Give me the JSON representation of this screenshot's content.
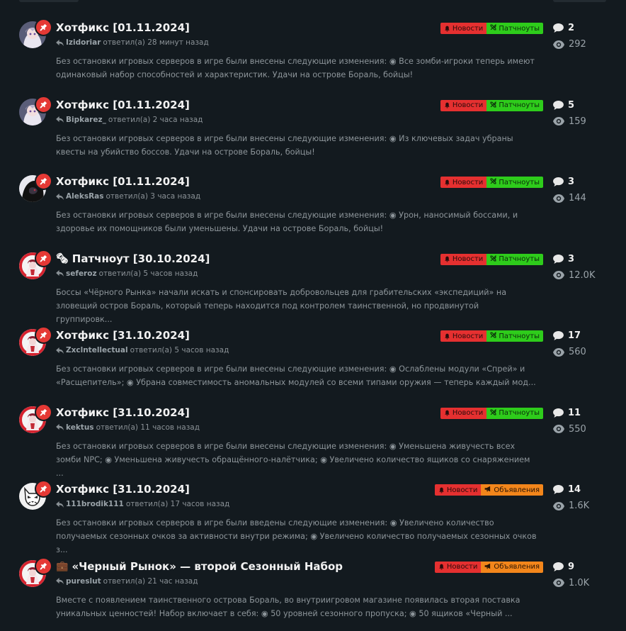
{
  "colors": {
    "background": "#131a1f",
    "pin": "#e53935",
    "tag_news": "#e53030",
    "tag_patch": "#2ecc1b",
    "tag_announce": "#f3861b"
  },
  "threads": [
    {
      "title": "Хотфикс [01.11.2024]",
      "title_icon": "",
      "user": "Izidoriar",
      "reply_text": "ответил(а) 28 минут назад",
      "excerpt": "Без остановки игровых серверов в игре были внесены следующие изменения: ◉ Все зомби-игроки теперь имеют одинаковый набор способностей и характеристик. Удачи на острове Бораль, бойцы!",
      "tag1": "Новости",
      "tag2": "Патчноуты",
      "tag2_type": "patch",
      "replies": "2",
      "views": "292",
      "avatar": "anime"
    },
    {
      "title": "Хотфикс [01.11.2024]",
      "title_icon": "",
      "user": "Bipkarez_",
      "reply_text": "ответил(а) 2 часа назад",
      "excerpt": "Без остановки игровых серверов в игре были внесены следующие изменения: ◉ Из ключевых задач убраны квесты на убийство боссов. Удачи на острове Бораль, бойцы!",
      "tag1": "Новости",
      "tag2": "Патчноуты",
      "tag2_type": "patch",
      "replies": "5",
      "views": "159",
      "avatar": "anime"
    },
    {
      "title": "Хотфикс [01.11.2024]",
      "title_icon": "",
      "user": "AleksRas",
      "reply_text": "ответил(а) 3 часа назад",
      "excerpt": "Без остановки игровых серверов в игре были внесены следующие изменения: ◉ Урон, наносимый боссами, и здоровье их помощников были уменьшены. Удачи на острове Бораль, бойцы!",
      "tag1": "Новости",
      "tag2": "Патчноуты",
      "tag2_type": "patch",
      "replies": "3",
      "views": "144",
      "avatar": "dark"
    },
    {
      "title": "Патчноут [30.10.2024]",
      "title_icon": "🗞",
      "user": "seferoz",
      "reply_text": "ответил(а) 5 часов назад",
      "excerpt": "Боссы «Чёрного Рынка» начали искать и спонсировать добровольцев для грабительских «экспедиций» на зловещий остров Бораль, который теперь находится под контролем таинственной, но продвинутой группировк...",
      "tag1": "Новости",
      "tag2": "Патчноуты",
      "tag2_type": "patch",
      "replies": "3",
      "views": "12.0K",
      "avatar": "red"
    },
    {
      "title": "Хотфикс [31.10.2024]",
      "title_icon": "",
      "user": "Zxclntellectual",
      "reply_text": "ответил(а) 5 часов назад",
      "excerpt": "Без остановки игровых серверов в игре были внесены следующие изменения: ◉ Ослаблены модули «Спрей» и «Расщепитель»; ◉ Убрана совместимость аномальных модулей со всеми типами оружия — теперь каждый мод...",
      "tag1": "Новости",
      "tag2": "Патчноуты",
      "tag2_type": "patch",
      "replies": "17",
      "views": "560",
      "avatar": "red"
    },
    {
      "title": "Хотфикс [31.10.2024]",
      "title_icon": "",
      "user": "kektus",
      "reply_text": "ответил(а) 11 часов назад",
      "excerpt": "Без остановки игровых серверов в игре были внесены следующие изменения: ◉ Уменьшена живучесть всех зомби NPC; ◉ Уменьшена живучесть обращённого-налётчика; ◉ Увеличено количество ящиков со снаряжением ...",
      "tag1": "Новости",
      "tag2": "Патчноуты",
      "tag2_type": "patch",
      "replies": "11",
      "views": "550",
      "avatar": "red"
    },
    {
      "title": "Хотфикс [31.10.2024]",
      "title_icon": "",
      "user": "111brodik111",
      "reply_text": "ответил(а) 17 часов назад",
      "excerpt": "Без остановки игровых серверов в игре были введены следующие изменения: ◉ Увеличено количество получаемых сезонных очков за активности внутри режима; ◉ Увеличено количество получаемых сезонных очков з...",
      "tag1": "Новости",
      "tag2": "Объявления",
      "tag2_type": "announce",
      "replies": "14",
      "views": "1.6K",
      "avatar": "wolf"
    },
    {
      "title": "«Черный Рынок» — второй Сезонный Набор",
      "title_icon": "💼",
      "user": "pureslut",
      "reply_text": "ответил(а) 21 час назад",
      "excerpt": "Вместе с появлением таинственного острова Бораль, во внутриигровом магазине появилась вторая поставка уникальных ценностей! Набор включает в себя: ◉ 50 уровней сезонного пропуска; ◉ 50 ящиков «Черный ...",
      "tag1": "Новости",
      "tag2": "Объявления",
      "tag2_type": "announce",
      "replies": "9",
      "views": "1.0K",
      "avatar": "red"
    }
  ]
}
